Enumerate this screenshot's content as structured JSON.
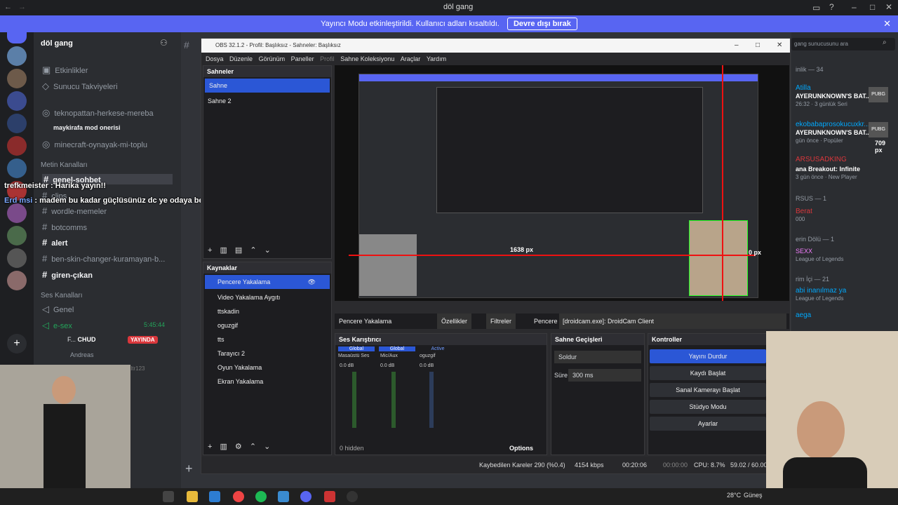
{
  "topbar": {
    "title": "döl gang"
  },
  "banner": {
    "text": "Yayıncı Modu etkinleştirildi. Kullanıcı adları kısaltıldı.",
    "button": "Devre dışı bırak"
  },
  "server": {
    "name": "döl gang",
    "search": "gang sunucusunu ara"
  },
  "channels": {
    "top": [
      "Etkinlikler",
      "Sunucu Takviyeleri"
    ],
    "list1": [
      "teknopattan-herkese-mereba",
      "maykirafa mod onerisi",
      "minecraft-oynayak-mi-toplu"
    ],
    "text_cat": "Metin Kanalları",
    "text": [
      "genel-sohbet",
      "clips",
      "wordle-memeler",
      "botcomms",
      "alert",
      "ben-skin-changer-kuramayan-b...",
      "giren-çıkan"
    ],
    "voice_cat": "Ses Kanalları",
    "voice": [
      "Genel",
      "e-sex"
    ],
    "voice_time": "5:45:44",
    "voice_users": [
      "F...",
      "CHUD",
      "YAYINDA",
      "Andreas",
      "altr123"
    ]
  },
  "overlay": {
    "line1_user": "trefkmeister",
    "line1_msg": "Harika yayın!!",
    "line2_user": "Erd msi",
    "line2_msg": "madem bu kadar güçlüsünüz dc ye odaya beklerizde bekoya çekilen muameleyi çekelim"
  },
  "members": {
    "header": "inlik — 34",
    "items": [
      {
        "name": "Atilla",
        "sub": "AYERUNKNOWN'S BAT...",
        "meta": "26:32 · 3 günlük Seri"
      },
      {
        "name": "ekobabaprosokucuxkr...",
        "sub": "AYERUNKNOWN'S BAT...",
        "meta": "gün önce · Popüler"
      },
      {
        "name": "ARSUSADKING",
        "sub": "ana Breakout: Infinite",
        "meta": "3 gün önce · New Player"
      },
      {
        "name": "RSUS — 1",
        "sub": "Berat",
        "meta": "000"
      },
      {
        "name": "erin Dölü — 1",
        "sub": "SEXX",
        "meta": "League of Legends"
      },
      {
        "name": "rim İçi — 21",
        "sub": "abi inanılmaz ya",
        "meta": "League of Legends"
      },
      {
        "name": "aega",
        "sub": "",
        "meta": ""
      }
    ]
  },
  "obs": {
    "title": "OBS 32.1.2 - Profil: Başlıksız - Sahneler: Başlıksız",
    "menu": [
      "Dosya",
      "Düzenle",
      "Görünüm",
      "Paneller",
      "Profil",
      "Sahne Koleksiyonu",
      "Araçlar",
      "Yardım"
    ],
    "scenes_title": "Sahneler",
    "scenes": [
      "Sahne",
      "Sahne 2"
    ],
    "sources_title": "Kaynaklar",
    "sources": [
      "Pencere Yakalama",
      "Video Yakalama Aygıtı",
      "ttskadin",
      "oguzgif",
      "tts",
      "Tarayıcı 2",
      "Oyun Yakalama",
      "Ekran Yakalama"
    ],
    "props": {
      "name": "Pencere Yakalama",
      "properties": "Özellikler",
      "filters": "Filtreler",
      "window_label": "Pencere",
      "window_value": "[droidcam.exe]: DroidCam Client"
    },
    "mixer_title": "Ses Karıştırıcı",
    "channels": [
      {
        "tag": "Global",
        "name": "Masaüstü Ses",
        "db": "0.0 dB"
      },
      {
        "tag": "Global",
        "name": "Mic/Aux",
        "db": "0.0 dB"
      },
      {
        "tag": "Active",
        "name": "oguzgif",
        "db": "0.0 dB"
      }
    ],
    "hidden": "0 hidden",
    "options": "Options",
    "trans_title": "Sahne Geçişleri",
    "transition": "Soldur",
    "duration_label": "Süre",
    "duration": "300 ms",
    "controls_title": "Kontroller",
    "controls": [
      "Yayını Durdur",
      "Kaydı Başlat",
      "Sanal Kamerayı Başlat",
      "Stüdyo Modu",
      "Ayarlar"
    ],
    "status": {
      "dropped": "Kaybedilen Kareler 290 (%0.4)",
      "kbps": "4154 kbps",
      "stream": "00:20:06",
      "rec": "00:00:00",
      "cpu": "CPU: 8.7%",
      "fps": "59.02 / 60.00"
    },
    "preview_px": [
      "1638 px",
      "0 px",
      "709 px"
    ]
  },
  "taskbar": {
    "weather": "28°C",
    "weather2": "Güneş"
  }
}
